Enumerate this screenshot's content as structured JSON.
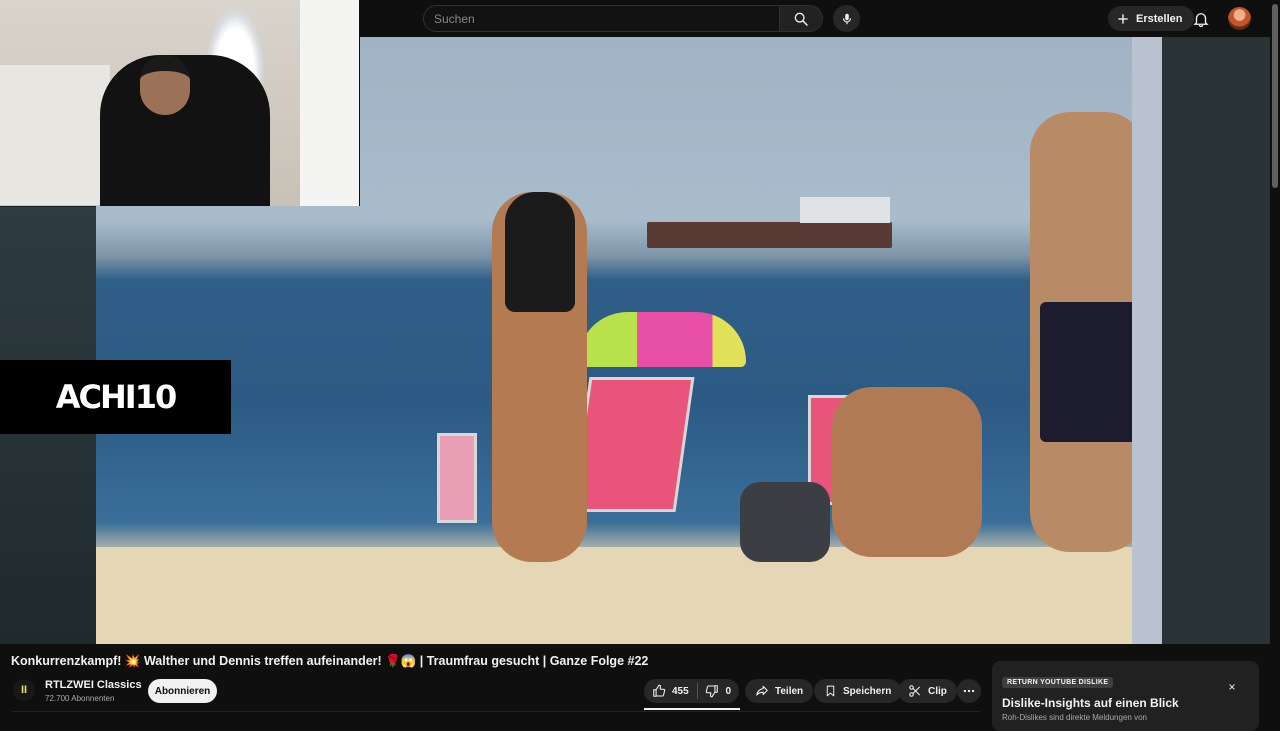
{
  "search": {
    "placeholder": "Suchen"
  },
  "header": {
    "create_label": "Erstellen"
  },
  "video": {
    "overlay_logo": "ACHI10",
    "title": "Konkurrenzkampf! 💥 Walther und Dennis treffen aufeinander! 🌹😱 | Traumfrau gesucht | Ganze Folge #22"
  },
  "channel": {
    "avatar_letter": "II",
    "name": "RTLZWEI Classics",
    "subscribers": "72.700 Abonnenten",
    "subscribe_label": "Abonnieren"
  },
  "actions": {
    "likes": "455",
    "dislikes": "0",
    "share_label": "Teilen",
    "save_label": "Speichern",
    "clip_label": "Clip"
  },
  "ryd": {
    "badge": "RETURN YOUTUBE DISLIKE",
    "title": "Dislike-Insights auf einen Blick",
    "text": "Roh-Dislikes sind direkte Meldungen von",
    "close": "×"
  },
  "icons": [
    "search-icon",
    "mic-icon",
    "plus-icon",
    "bell-icon",
    "like-icon",
    "dislike-icon",
    "share-icon",
    "save-icon",
    "clip-icon",
    "more-icon",
    "close-icon"
  ],
  "colors": {
    "background": "#0f0f0f",
    "pill": "#272727",
    "subscribe_bg": "#f1f1f1",
    "channel_logo": "#e7e34a"
  }
}
